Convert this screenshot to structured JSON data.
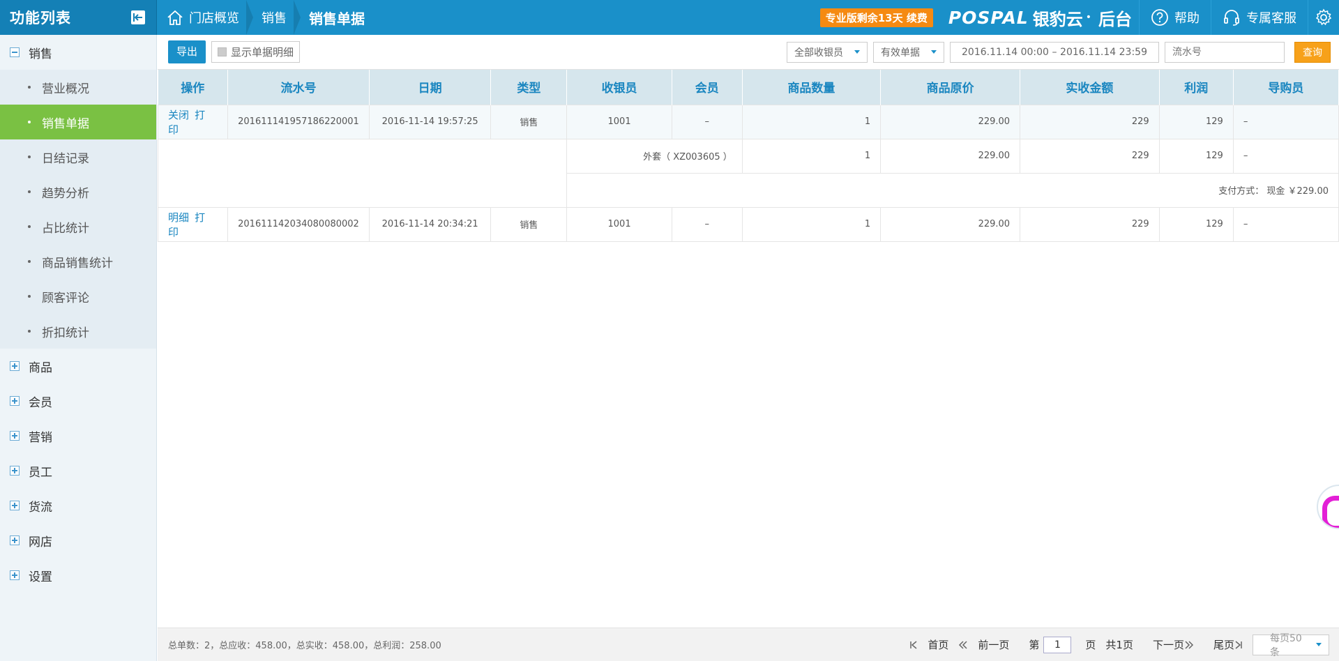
{
  "topbar": {
    "brand_title": "功能列表",
    "breadcrumbs": [
      "门店概览",
      "销售",
      "销售单据"
    ],
    "renew_badge": "专业版剩余13天 续费",
    "logo_text": "POSPAL",
    "logo_cn": "银豹云",
    "logo_dot": "•",
    "logo_suffix": "后台",
    "help_label": "帮助",
    "service_label": "专属客服",
    "colors": {
      "bar": "#1a90c9",
      "badge": "#f58a12"
    }
  },
  "sidebar": {
    "groups": [
      {
        "label": "销售",
        "expanded": true,
        "items": [
          {
            "label": "营业概况"
          },
          {
            "label": "销售单据",
            "active": true
          },
          {
            "label": "日结记录"
          },
          {
            "label": "趋势分析"
          },
          {
            "label": "占比统计"
          },
          {
            "label": "商品销售统计"
          },
          {
            "label": "顾客评论"
          },
          {
            "label": "折扣统计"
          }
        ]
      },
      {
        "label": "商品"
      },
      {
        "label": "会员"
      },
      {
        "label": "营销"
      },
      {
        "label": "员工"
      },
      {
        "label": "货流"
      },
      {
        "label": "网店"
      },
      {
        "label": "设置"
      }
    ]
  },
  "toolbar": {
    "export_label": "导出",
    "show_detail_label": "显示单据明细",
    "cashier_select": "全部收银员",
    "receipt_select": "有效单据",
    "date_start": "2016.11.14 00:00",
    "date_sep": "–",
    "date_end": "2016.11.14 23:59",
    "serial_placeholder": "流水号",
    "query_label": "查询"
  },
  "table": {
    "headers": [
      "操作",
      "流水号",
      "日期",
      "类型",
      "收银员",
      "会员",
      "商品数量",
      "商品原价",
      "实收金额",
      "利润",
      "导购员"
    ],
    "rows": [
      {
        "op_1": "关闭",
        "op_2": "打印",
        "serial": "201611141957186220001",
        "date": "2016-11-14 19:57:25",
        "type": "销售",
        "cashier": "1001",
        "member": "–",
        "qty": "1",
        "orig_price": "229.00",
        "paid": "229",
        "profit": "129",
        "guide": "–"
      },
      {
        "op_1": "明细",
        "op_2": "打印",
        "serial": "201611142034080080002",
        "date": "2016-11-14 20:34:21",
        "type": "销售",
        "cashier": "1001",
        "member": "–",
        "qty": "1",
        "orig_price": "229.00",
        "paid": "229",
        "profit": "129",
        "guide": "–"
      }
    ],
    "detail": {
      "item_name": "外套（ XZ003605 ）",
      "qty": "1",
      "orig_price": "229.00",
      "paid": "229",
      "profit": "129",
      "guide": "–",
      "payment": "支付方式：  现金   ￥229.00"
    }
  },
  "footer": {
    "summary": "总单数：2，总应收：458.00，总实收：458.00，总利润：258.00",
    "first": "首页",
    "prev": "前一页",
    "page_prefix": "第",
    "page_value": "1",
    "page_suffix": "页",
    "total_pages": "共1页",
    "next": "下一页",
    "last": "尾页",
    "per_page": "每页50条"
  }
}
